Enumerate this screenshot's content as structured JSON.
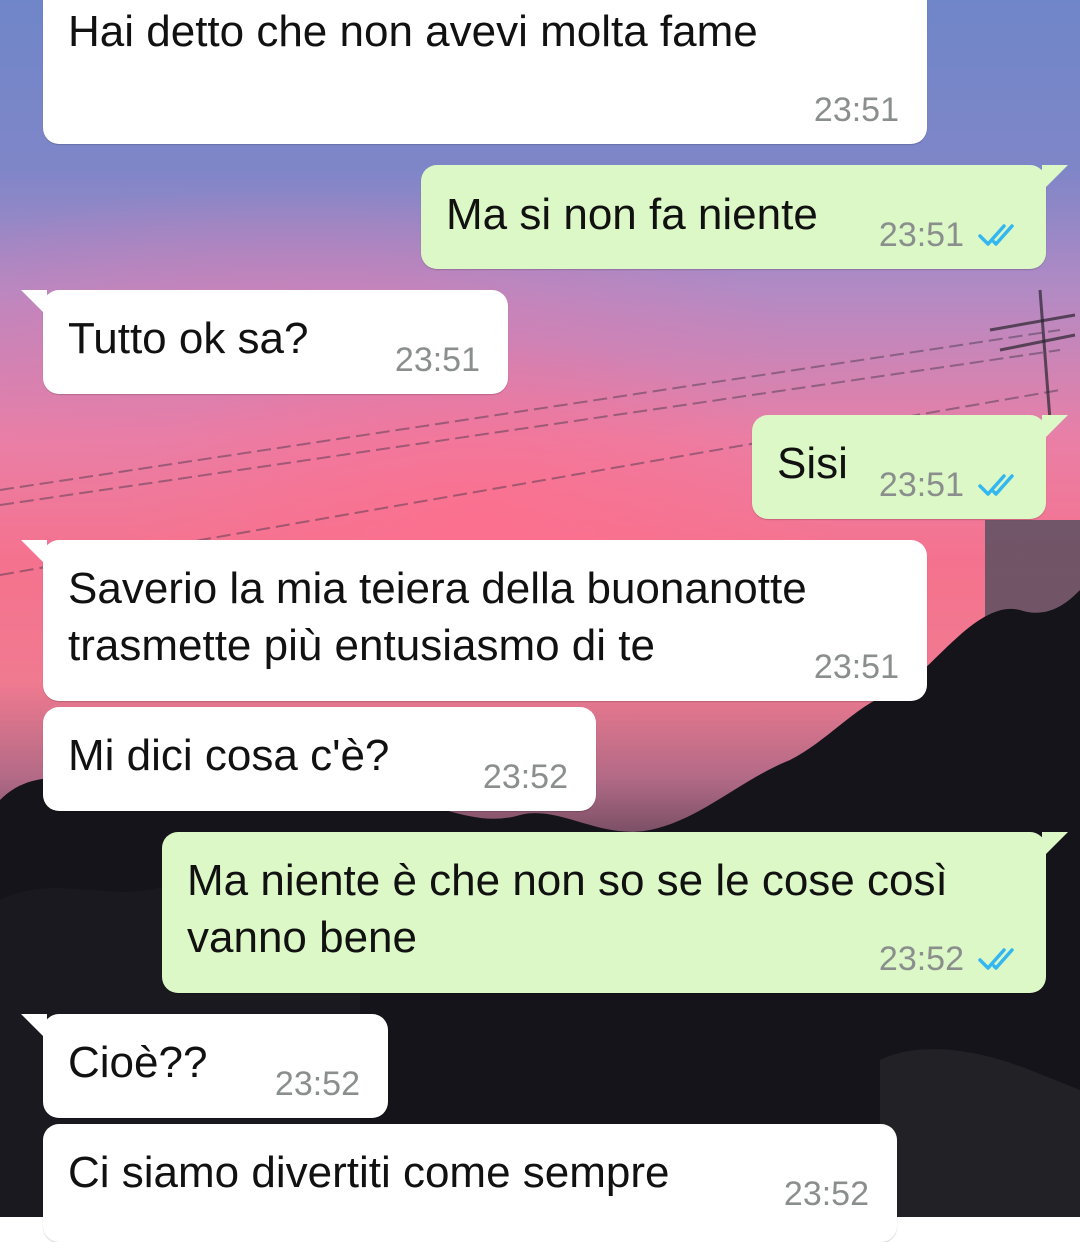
{
  "messages": [
    {
      "direction": "in",
      "text": "Hai detto che non avevi molta fame",
      "time": "23:51"
    },
    {
      "direction": "out",
      "text": "Ma si non fa niente",
      "time": "23:51",
      "status": "read-double-check-icon"
    },
    {
      "direction": "in",
      "text": "Tutto ok sa?",
      "time": "23:51"
    },
    {
      "direction": "out",
      "text": "Sisi",
      "time": "23:51",
      "status": "read-double-check-icon"
    },
    {
      "direction": "in",
      "text": "Saverio la mia teiera della buonanotte",
      "text2": "trasmette più entusiasmo di te",
      "time": "23:51"
    },
    {
      "direction": "in",
      "text": "Mi dici cosa c'è?",
      "time": "23:52"
    },
    {
      "direction": "out",
      "text": "Ma niente è che non so se le cose così",
      "text2": "vanno bene",
      "time": "23:52",
      "status": "read-double-check-icon"
    },
    {
      "direction": "in",
      "text": "Cioè??",
      "time": "23:52"
    },
    {
      "direction": "in",
      "text": "Ci siamo divertiti come sempre",
      "time": "23:52"
    }
  ],
  "colors": {
    "incoming_bubble": "#ffffff",
    "outgoing_bubble": "#dcf8c6",
    "timestamp": "#8a8f8e",
    "read_tick": "#34b7f1"
  }
}
